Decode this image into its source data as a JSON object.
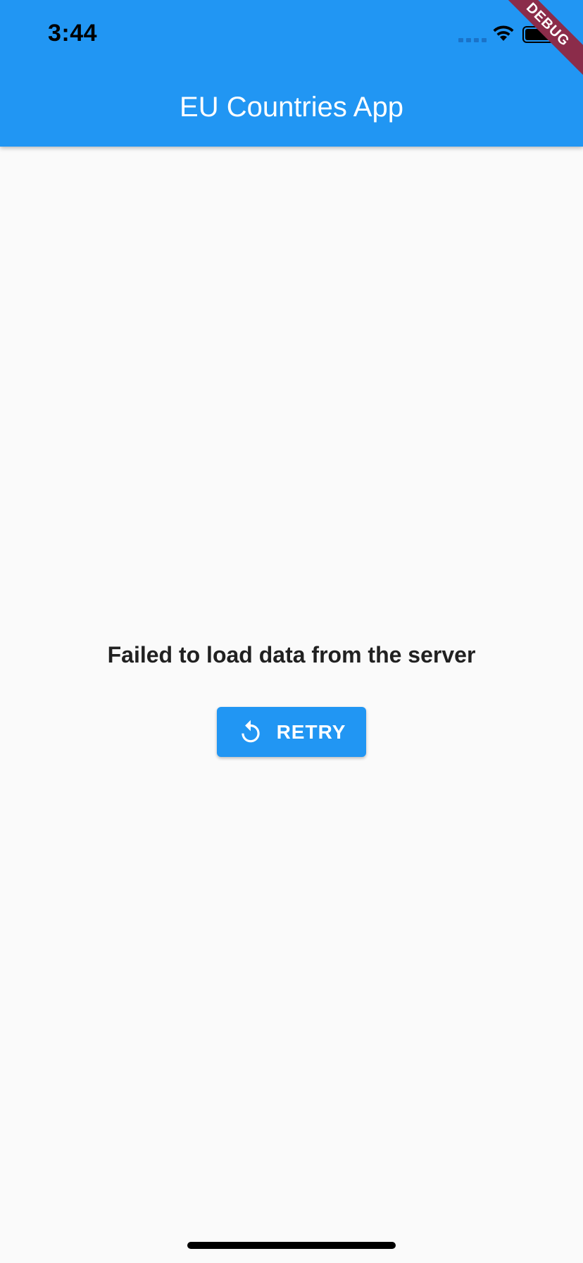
{
  "status_bar": {
    "time": "3:44",
    "icons": [
      "cellular-signal-icon",
      "wifi-icon",
      "battery-icon"
    ]
  },
  "app_bar": {
    "title": "EU Countries App",
    "background_color": "#2196f3"
  },
  "debug_banner": {
    "label": "DEBUG",
    "color": "#8b2c4a"
  },
  "error": {
    "message": "Failed to load data from the server"
  },
  "retry_button": {
    "label": "RETRY",
    "icon": "refresh-icon",
    "color": "#2196f3"
  }
}
